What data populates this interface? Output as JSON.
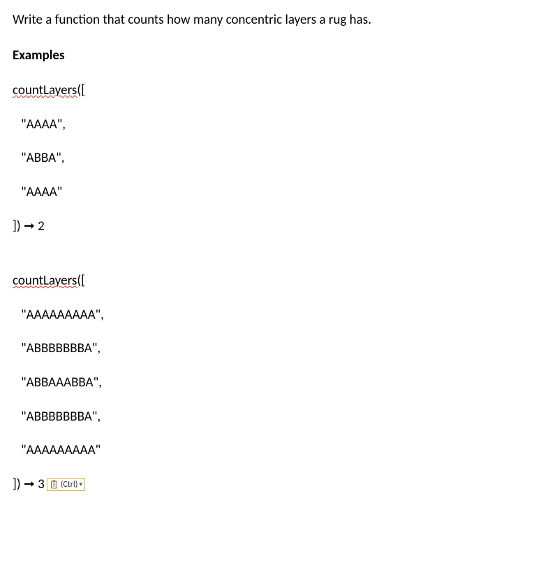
{
  "intro": "Write a function that counts how many concentric layers a rug has.",
  "examplesHeading": "Examples",
  "example1": {
    "callOpen1": "countLayers",
    "callOpen2": "([",
    "args": [
      "\"AAAA\",",
      "\"ABBA\",",
      "\"AAAA\""
    ],
    "callClose": "]) ➞ 2"
  },
  "example2": {
    "callOpen1": "countLayers",
    "callOpen2": "([",
    "args": [
      "\"AAAAAAAAA\",",
      "\"ABBBBBBBA\",",
      "\"ABBAAABBA\",",
      "\"ABBBBBBBA\",",
      "\"AAAAAAAAA\""
    ],
    "callClose": "]) ➞ 3"
  },
  "pasteWidget": {
    "label": "(Ctrl)"
  }
}
